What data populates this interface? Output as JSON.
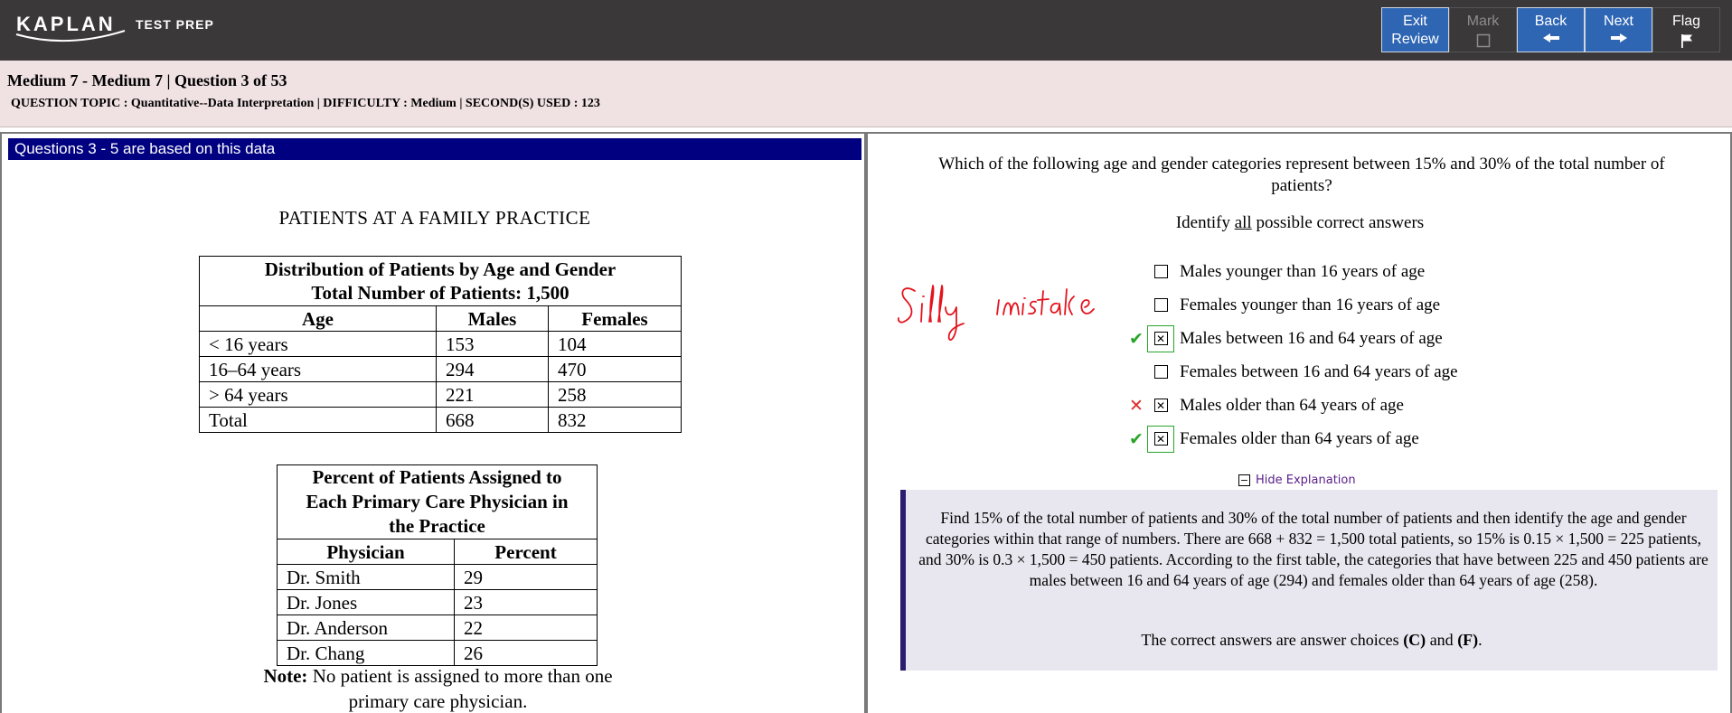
{
  "header": {
    "logo_text": "KAPLAN",
    "logo_subtext": "TEST PREP",
    "buttons": {
      "exit_line1": "Exit",
      "exit_line2": "Review",
      "mark": "Mark",
      "back": "Back",
      "next": "Next",
      "flag": "Flag"
    }
  },
  "info": {
    "line1": "Medium 7 - Medium 7 | Question  3 of 53",
    "line2": "QUESTION TOPIC : Quantitative--Data Interpretation | DIFFICULTY : Medium | SECOND(S) USED : 123"
  },
  "passage": {
    "header": "Questions 3 - 5 are based on this data",
    "title": "PATIENTS AT A FAMILY PRACTICE",
    "table1": {
      "caption_line1": "Distribution of Patients by Age and Gender",
      "caption_line2": "Total Number of Patients: 1,500",
      "headers": [
        "Age",
        "Males",
        "Females"
      ],
      "rows": [
        [
          "< 16 years",
          "153",
          "104"
        ],
        [
          "16–64 years",
          "294",
          "470"
        ],
        [
          "> 64 years",
          "221",
          "258"
        ],
        [
          "Total",
          "668",
          "832"
        ]
      ]
    },
    "table2": {
      "caption_line1": "Percent of Patients Assigned to",
      "caption_line2": "Each Primary Care Physician in",
      "caption_line3": "the Practice",
      "headers": [
        "Physician",
        "Percent"
      ],
      "rows": [
        [
          "Dr. Smith",
          "29"
        ],
        [
          "Dr. Jones",
          "23"
        ],
        [
          "Dr. Anderson",
          "22"
        ],
        [
          "Dr. Chang",
          "26"
        ]
      ]
    },
    "note_label": "Note:",
    "note_text": " No patient is assigned to more than one primary care physician."
  },
  "question": {
    "stem": "Which of the following age and gender categories represent between 15% and 30% of the total number of patients?",
    "instruction_pre": "Identify ",
    "instruction_underlined": "all",
    "instruction_post": " possible correct answers",
    "choices": [
      {
        "label": "Males younger than 16 years of age",
        "checked": false,
        "result": ""
      },
      {
        "label": "Females younger than 16 years of age",
        "checked": false,
        "result": ""
      },
      {
        "label": "Males between 16 and 64 years of age",
        "checked": true,
        "result": "correct"
      },
      {
        "label": "Females between 16 and 64 years of age",
        "checked": false,
        "result": ""
      },
      {
        "label": "Males older than 64 years of age",
        "checked": true,
        "result": "wrong"
      },
      {
        "label": "Females older than 64 years of age",
        "checked": true,
        "result": "correct"
      }
    ],
    "hide_explanation": "Hide Explanation",
    "explanation": "Find 15% of the total number of patients and 30% of the total number of patients and then identify the age and gender categories within that range of numbers. There are 668 + 832 = 1,500 total patients, so 15% is 0.15 × 1,500 = 225 patients, and 30% is 0.3 × 1,500 = 450 patients. According to the first table, the categories that have between 225 and 450 patients are males between 16 and 64 years of age (294) and females older than 64 years of age (258).",
    "answer_pre": "The correct answers are answer choices ",
    "answer_c": "(C)",
    "answer_mid": " and ",
    "answer_f": "(F)",
    "answer_post": "."
  },
  "annotation": {
    "handwriting": "Silly mistake",
    "color": "#e4141e"
  },
  "colors": {
    "topbar": "#3a3838",
    "button_blue": "#2f66b4",
    "infobar": "#f0e1e3",
    "passage_header": "#000080",
    "explanation_bg": "#e8e6ee",
    "explanation_border": "#2b1c70",
    "correct": "#2aa52a",
    "wrong": "#e02a2a"
  }
}
